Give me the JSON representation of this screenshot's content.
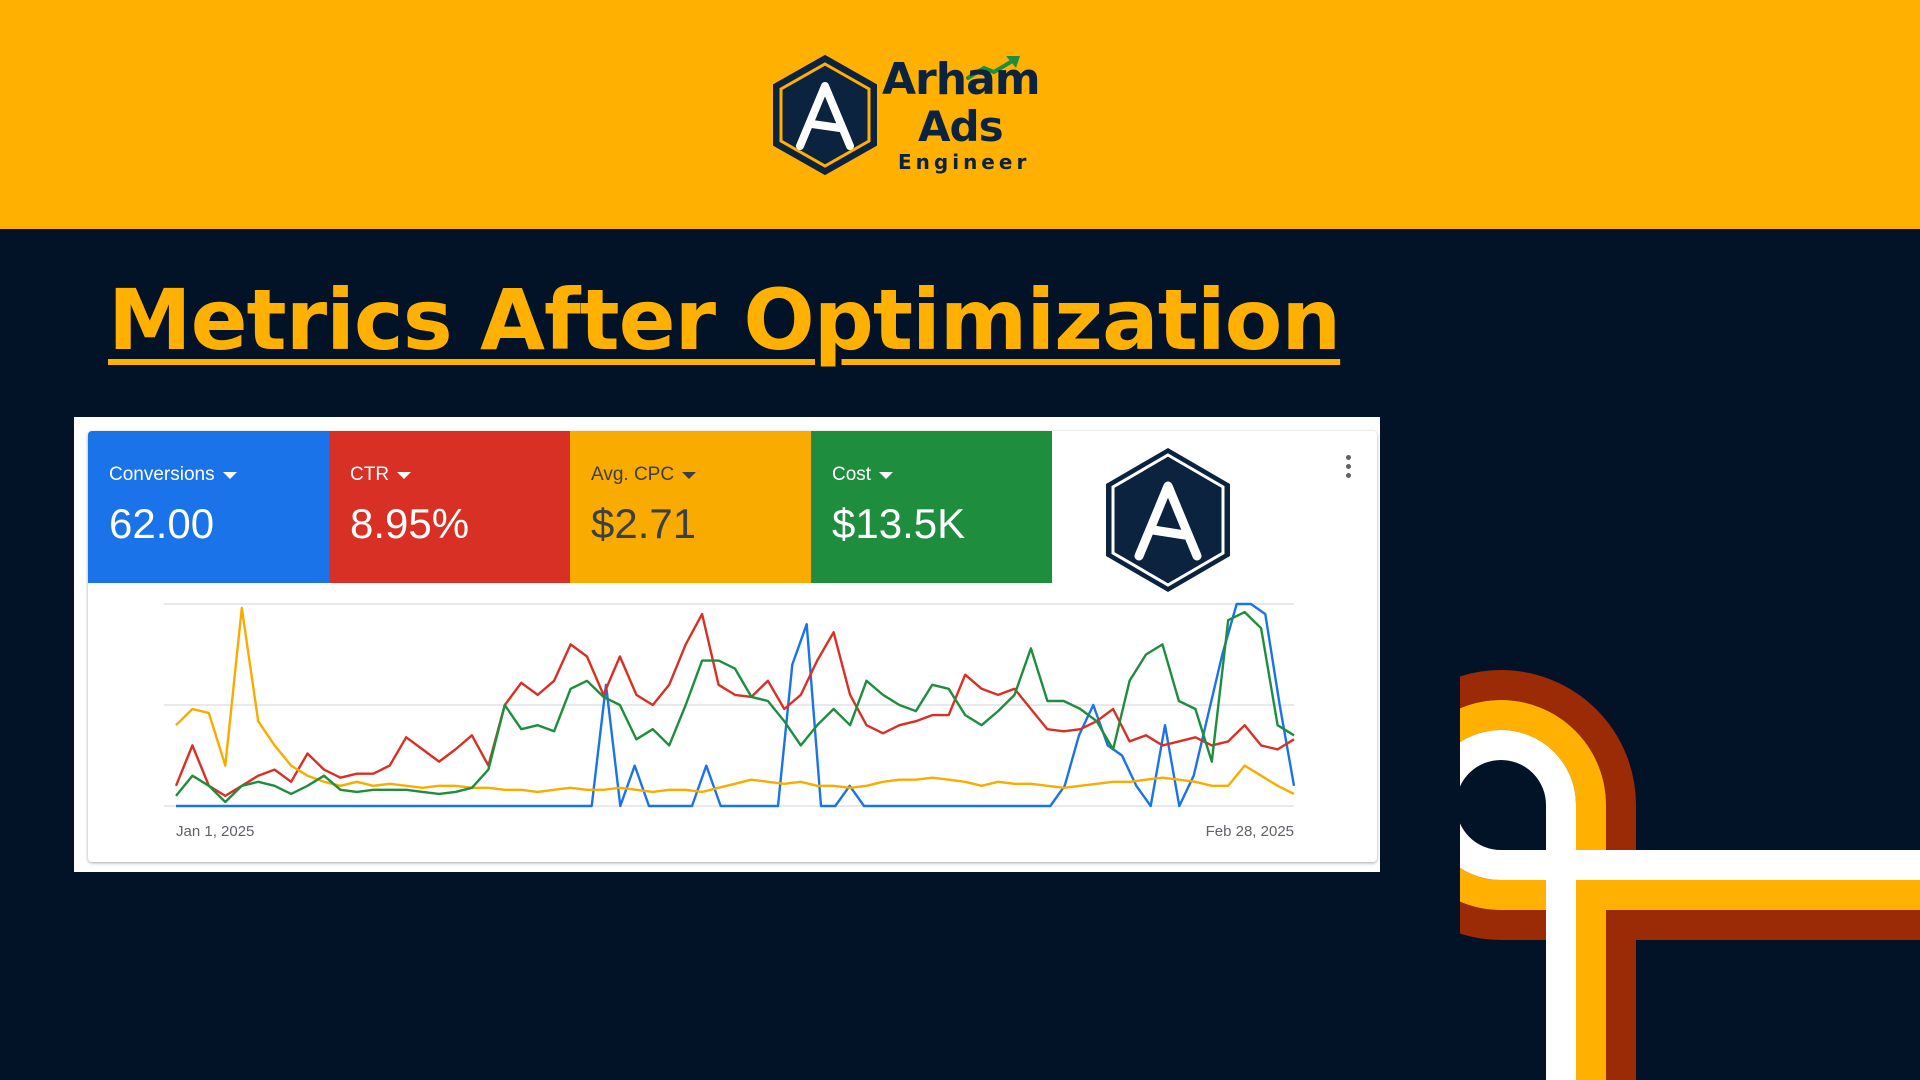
{
  "header": {
    "logo_line1": "Arham",
    "logo_line2": "Ads",
    "logo_line3": "Engineer",
    "logo_icon": "hexagon-a-logo",
    "background": "#FFB000"
  },
  "title": "Metrics After Optimization",
  "metrics": [
    {
      "label": "Conversions",
      "value": "62.00",
      "color": "#1A73E8"
    },
    {
      "label": "CTR",
      "value": "8.95%",
      "color": "#D93025"
    },
    {
      "label": "Avg. CPC",
      "value": "$2.71",
      "color": "#F9AB00"
    },
    {
      "label": "Cost",
      "value": "$13.5K",
      "color": "#1E8E3E"
    }
  ],
  "more_icon": "more-vert-icon",
  "chart_data": {
    "type": "line",
    "x_start_label": "Jan 1, 2025",
    "x_end_label": "Feb 28, 2025",
    "grid": true,
    "ylim": [
      0,
      1
    ],
    "series": [
      {
        "color": "#1A73E8",
        "values": [
          0,
          0,
          0,
          0,
          0,
          0,
          0,
          0,
          0,
          0,
          0,
          0,
          0,
          0,
          0,
          0,
          0,
          0,
          0,
          0,
          0,
          0,
          0,
          0,
          0,
          0,
          0,
          0,
          0,
          0,
          0.6,
          0,
          0.2,
          0,
          0,
          0,
          0,
          0.2,
          0,
          0,
          0,
          0,
          0,
          0.7,
          0.9,
          0,
          0,
          0.1,
          0,
          0,
          0,
          0,
          0,
          0,
          0,
          0,
          0,
          0,
          0,
          0,
          0,
          0,
          0.1,
          0.35,
          0.5,
          0.3,
          0.25,
          0.1,
          0,
          0.4,
          0,
          0.15,
          0.45,
          0.75,
          1.0,
          1.0,
          0.95,
          0.5,
          0.1
        ]
      },
      {
        "color": "#D93025",
        "values": [
          0.1,
          0.3,
          0.1,
          0.05,
          0.1,
          0.15,
          0.18,
          0.12,
          0.26,
          0.18,
          0.14,
          0.16,
          0.16,
          0.2,
          0.34,
          0.28,
          0.22,
          0.28,
          0.35,
          0.2,
          0.5,
          0.61,
          0.55,
          0.62,
          0.8,
          0.74,
          0.55,
          0.74,
          0.55,
          0.5,
          0.6,
          0.8,
          0.95,
          0.6,
          0.55,
          0.54,
          0.62,
          0.48,
          0.55,
          0.72,
          0.86,
          0.55,
          0.4,
          0.36,
          0.4,
          0.42,
          0.45,
          0.45,
          0.65,
          0.58,
          0.55,
          0.58,
          0.48,
          0.38,
          0.37,
          0.38,
          0.42,
          0.48,
          0.32,
          0.35,
          0.3,
          0.32,
          0.34,
          0.3,
          0.32,
          0.4,
          0.3,
          0.28,
          0.33
        ]
      },
      {
        "color": "#F9AB00",
        "values": [
          0.4,
          0.48,
          0.46,
          0.2,
          0.98,
          0.42,
          0.3,
          0.2,
          0.15,
          0.12,
          0.1,
          0.12,
          0.1,
          0.11,
          0.1,
          0.09,
          0.1,
          0.1,
          0.09,
          0.09,
          0.08,
          0.08,
          0.07,
          0.08,
          0.09,
          0.08,
          0.08,
          0.09,
          0.08,
          0.07,
          0.08,
          0.08,
          0.07,
          0.09,
          0.11,
          0.13,
          0.12,
          0.11,
          0.12,
          0.1,
          0.1,
          0.09,
          0.1,
          0.12,
          0.13,
          0.13,
          0.14,
          0.13,
          0.12,
          0.1,
          0.12,
          0.11,
          0.11,
          0.1,
          0.09,
          0.1,
          0.11,
          0.12,
          0.12,
          0.13,
          0.14,
          0.13,
          0.12,
          0.1,
          0.1,
          0.2,
          0.15,
          0.1,
          0.06
        ]
      },
      {
        "color": "#1E8E3E",
        "values": [
          0.05,
          0.15,
          0.1,
          0.02,
          0.1,
          0.12,
          0.1,
          0.06,
          0.1,
          0.15,
          0.08,
          0.07,
          0.08,
          0.08,
          0.08,
          0.07,
          0.06,
          0.07,
          0.09,
          0.18,
          0.5,
          0.38,
          0.4,
          0.37,
          0.58,
          0.62,
          0.54,
          0.5,
          0.33,
          0.38,
          0.3,
          0.5,
          0.72,
          0.72,
          0.68,
          0.54,
          0.52,
          0.42,
          0.3,
          0.4,
          0.48,
          0.4,
          0.62,
          0.55,
          0.5,
          0.47,
          0.6,
          0.58,
          0.45,
          0.4,
          0.47,
          0.55,
          0.78,
          0.52,
          0.52,
          0.48,
          0.42,
          0.28,
          0.62,
          0.75,
          0.8,
          0.52,
          0.48,
          0.22,
          0.92,
          0.96,
          0.88,
          0.4,
          0.35
        ]
      }
    ]
  }
}
